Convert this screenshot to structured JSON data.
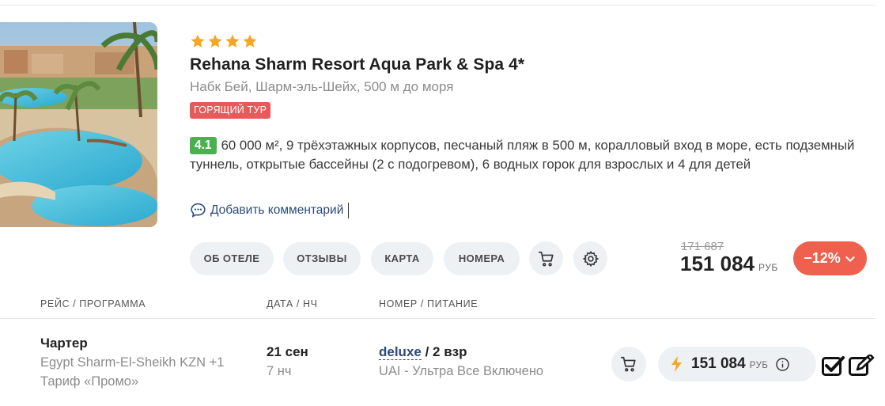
{
  "hotel": {
    "stars": 4,
    "name": "Rehana Sharm Resort Aqua Park & Spa 4*",
    "location": "Набк Бей, Шарм-эль-Шейх, 500 м до моря",
    "badge": "ГОРЯЩИЙ ТУР",
    "rating": "4.1",
    "description": "60 000 м², 9 трёхэтажных корпусов, песчаный пляж в 500 м, коралловый вход в море, есть подземный туннель, открытые бассейны (2 с подогревом), 6 водных горок для взрослых и 4 для детей",
    "comment_link": "Добавить комментарий"
  },
  "actions": {
    "about": "ОБ ОТЕЛЕ",
    "reviews": "ОТЗЫВЫ",
    "map": "КАРТА",
    "rooms": "НОМЕРА"
  },
  "price": {
    "old": "171 687",
    "current": "151 084",
    "currency": "РУБ",
    "discount": "−12%"
  },
  "table": {
    "headers": {
      "flight": "РЕЙС / ПРОГРАММА",
      "date": "ДАТА / НЧ",
      "room": "НОМЕР / ПИТАНИЕ"
    },
    "rows": [
      {
        "flight_type": "Чартер",
        "route": "Egypt Sharm-El-Sheikh KZN +1",
        "tariff": "Тариф «Промо»",
        "date": "21 сен",
        "nights": "7 нч",
        "room_type": "deluxe",
        "occupancy": " / 2 взр",
        "meal": "UAI - Ультра Все Включено",
        "price": "151 084",
        "currency": "РУБ"
      }
    ]
  },
  "colors": {
    "accent_red": "#f0604f",
    "hot_badge": "#e85a5a",
    "rating_green": "#4caf50",
    "star_gold": "#f5a623",
    "pill_bg": "#eef1f4",
    "link_blue": "#2b4a7a"
  },
  "icons": [
    "star-icon",
    "comment-icon",
    "cart-icon",
    "gear-icon",
    "chevron-down-icon",
    "lightning-icon",
    "info-icon",
    "checkbox-checked-icon",
    "edit-icon"
  ]
}
